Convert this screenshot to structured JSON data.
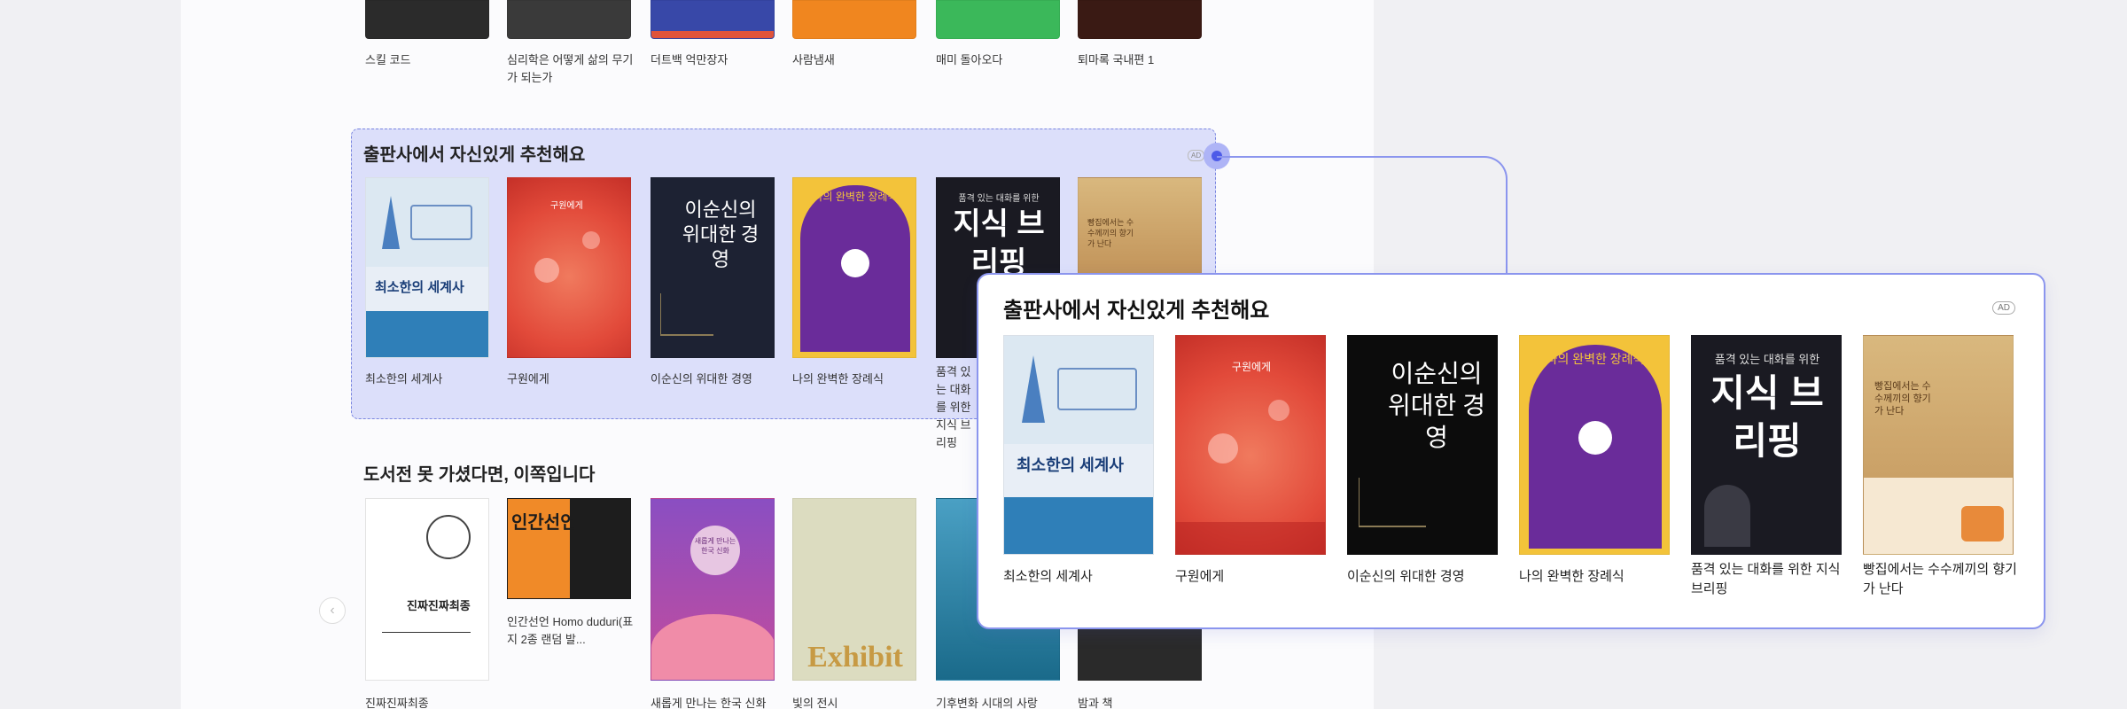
{
  "top_row": {
    "items": [
      {
        "title": "스킬 코드"
      },
      {
        "title": "심리학은 어떻게 삶의 무기가 되는가"
      },
      {
        "title": "더트백 억만장자"
      },
      {
        "title": "사람냄새"
      },
      {
        "title": "매미 돌아오다"
      },
      {
        "title": "퇴마록 국내편 1"
      }
    ]
  },
  "publisher_section": {
    "title": "출판사에서 자신있게 추천해요",
    "ad_badge": "AD",
    "items": [
      {
        "title": "최소한의 세계사",
        "cover_text": "최소한의 세계사"
      },
      {
        "title": "구원에게",
        "cover_text": "구원에게"
      },
      {
        "title": "이순신의 위대한 경영",
        "cover_text": "이순신의 위대한 경영"
      },
      {
        "title": "나의 완벽한 장례식",
        "cover_text": "나의 완벽한 장례식"
      },
      {
        "title": "품격 있는 대화를 위한 지식 브리핑",
        "cover_text": "지식 브리핑",
        "cover_subtext": "품격 있는 대화를 위한"
      },
      {
        "title": "빵집에서는 수수께끼의 향기가 난다",
        "cover_text": "빵집에서는 수수께끼의 향기가 난다"
      }
    ]
  },
  "bookfair_section": {
    "title": "도서전 못 가셨다면, 이쪽입니다",
    "items": [
      {
        "title": "진짜진짜최종",
        "cover_text": "진짜진짜최종"
      },
      {
        "title": "인간선언 Homo duduri(표지 2종 랜덤 발...",
        "cover_text": "인간선언"
      },
      {
        "title": "새롭게 만나는 한국 신화",
        "cover_text": "새롭게 만나는 한국 신화"
      },
      {
        "title": "빛의 전시",
        "cover_text": "Exhibit"
      },
      {
        "title": "기후변화 시대의 사랑"
      },
      {
        "title": "밤과 책"
      }
    ]
  },
  "popup": {
    "title": "출판사에서 자신있게 추천해요",
    "ad_badge": "AD"
  },
  "colors": {
    "highlight": "#8c96f5",
    "accent": "#4d5be8"
  }
}
